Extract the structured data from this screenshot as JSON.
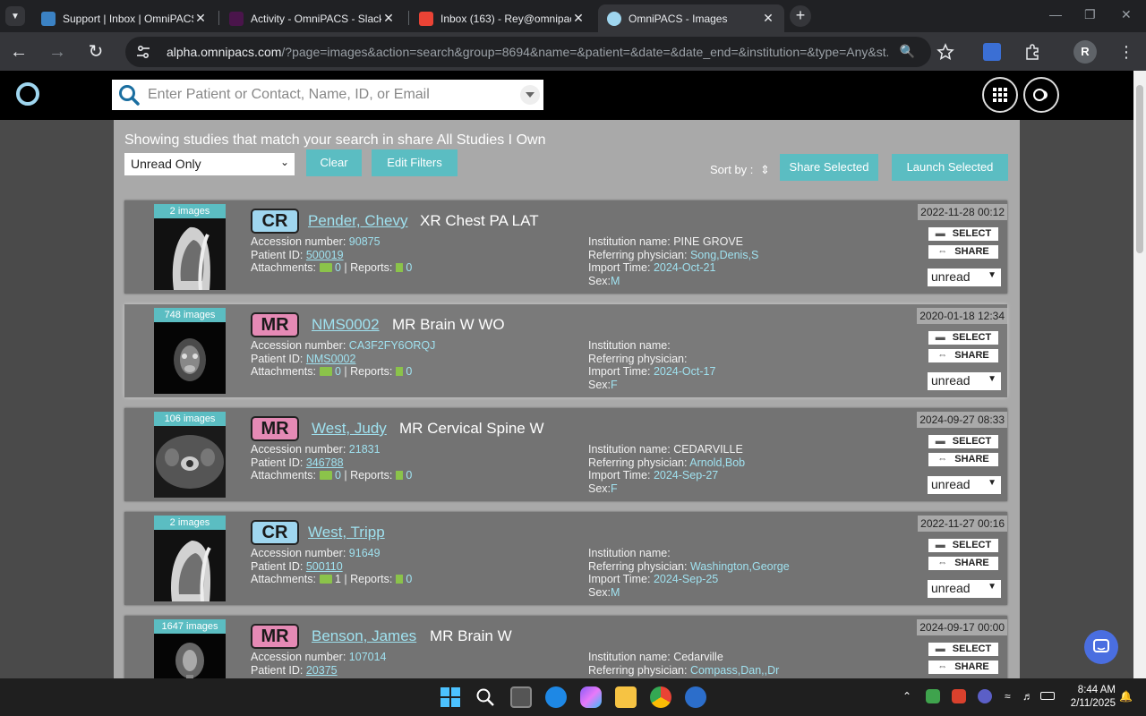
{
  "browser": {
    "tabs": [
      {
        "title": "Support | Inbox | OmniPACS",
        "favicon_color": "#3b82c4",
        "active": false
      },
      {
        "title": "Activity - OmniPACS - Slack",
        "favicon_color": "#4a154b",
        "active": false
      },
      {
        "title": "Inbox (163) - Rey@omnipacs",
        "favicon_color": "#ea4335",
        "active": false
      },
      {
        "title": "OmniPACS - Images",
        "favicon_color": "#9fd6ef",
        "active": true
      }
    ],
    "url_host": "alpha.omnipacs.com",
    "url_rest": "/?page=images&action=search&group=8694&name=&patient=&date=&date_end=&institution=&type=Any&st...",
    "profile_initial": "R"
  },
  "app": {
    "search_placeholder": "Enter Patient or Contact, Name, ID, or Email",
    "summary": "Showing studies that match your search in share All Studies I Own",
    "filter_value": "Unread Only",
    "clear_label": "Clear",
    "edit_filters_label": "Edit Filters",
    "sort_label": "Sort by :",
    "share_selected_label": "Share Selected",
    "launch_selected_label": "Launch Selected"
  },
  "labels": {
    "accession": "Accession number:",
    "patient_id": "Patient ID:",
    "attachments": "Attachments:",
    "reports": "| Reports:",
    "institution": "Institution name:",
    "referring": "Referring physician:",
    "import_time": "Import Time:",
    "sex": "Sex:",
    "select_btn": "SELECT",
    "share_btn": "SHARE"
  },
  "studies": [
    {
      "images": "2 images",
      "modality": "CR",
      "patient": "Pender, Chevy",
      "description": "XR Chest PA LAT",
      "accession": "90875",
      "patient_id": "500019",
      "attachments": "0",
      "reports": "0",
      "institution": "PINE GROVE",
      "referring": "Song,Denis,S",
      "import_time": "2024-Oct-21",
      "sex": "M",
      "date": "2022-11-28 00:12",
      "status": "unread"
    },
    {
      "images": "748 images",
      "modality": "MR",
      "patient": "NMS0002",
      "description": "MR Brain W WO",
      "accession": "CA3F2FY6ORQJ",
      "patient_id": "NMS0002",
      "attachments": "0",
      "reports": "0",
      "institution": "",
      "referring": "",
      "import_time": "2024-Oct-17",
      "sex": "F",
      "date": "2020-01-18 12:34",
      "status": "unread"
    },
    {
      "images": "106 images",
      "modality": "MR",
      "patient": "West, Judy",
      "description": "MR Cervical Spine W",
      "accession": "21831",
      "patient_id": "346788",
      "attachments": "0",
      "reports": "0",
      "institution": "CEDARVILLE",
      "referring": "Arnold,Bob",
      "import_time": "2024-Sep-27",
      "sex": "F",
      "date": "2024-09-27 08:33",
      "status": "unread"
    },
    {
      "images": "2 images",
      "modality": "CR",
      "patient": "West, Tripp",
      "description": "",
      "accession": "91649",
      "patient_id": "500110",
      "attachments": "1",
      "reports": "0",
      "institution": "",
      "referring": "Washington,George",
      "import_time": "2024-Sep-25",
      "sex": "M",
      "date": "2022-11-27 00:16",
      "status": "unread"
    },
    {
      "images": "1647 images",
      "modality": "MR",
      "patient": "Benson, James",
      "description": "MR Brain W",
      "accession": "107014",
      "patient_id": "20375",
      "attachments": "",
      "reports": "",
      "institution": "Cedarville",
      "referring": "Compass,Dan,,Dr",
      "import_time": "",
      "sex": "",
      "date": "2024-09-17 00:00",
      "status": ""
    }
  ],
  "taskbar": {
    "time": "8:44 AM",
    "date": "2/11/2025"
  }
}
